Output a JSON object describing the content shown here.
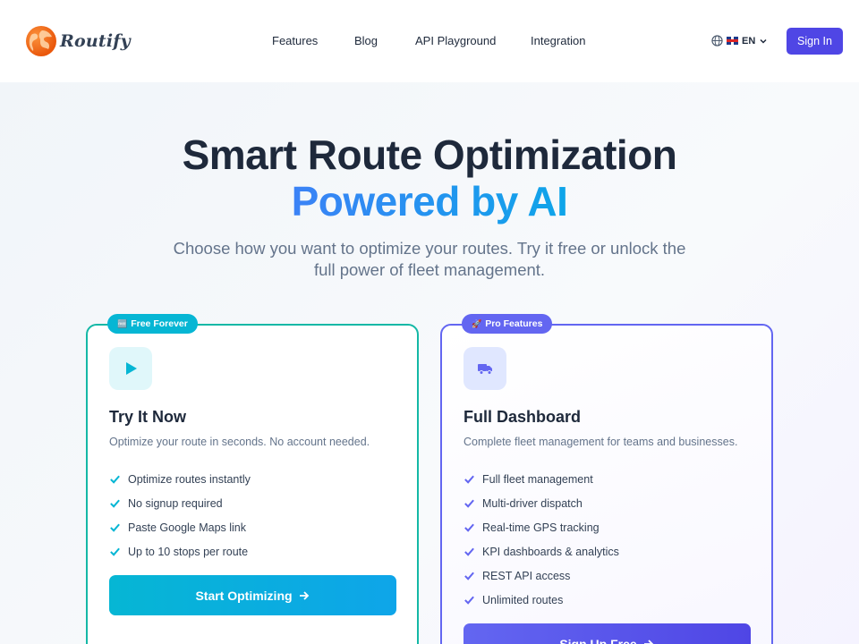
{
  "brand": {
    "name": "Routify"
  },
  "nav": {
    "links": [
      "Features",
      "Blog",
      "API Playground",
      "Integration"
    ]
  },
  "language": {
    "code": "EN",
    "flag": "🇬🇧"
  },
  "signin_label": "Sign In",
  "hero": {
    "title_line1": "Smart Route Optimization",
    "title_line2": "Powered by AI",
    "subtitle": "Choose how you want to optimize your routes. Try it free or unlock the full power of fleet management."
  },
  "free_card": {
    "badge": "Free Forever",
    "badge_icon": "🆓",
    "icon": "play-icon",
    "title": "Try It Now",
    "description": "Optimize your route in seconds. No account needed.",
    "features": [
      "Optimize routes instantly",
      "No signup required",
      "Paste Google Maps link",
      "Up to 10 stops per route"
    ],
    "cta": "Start Optimizing",
    "accent": "#06b6d4"
  },
  "pro_card": {
    "badge": "Pro Features",
    "badge_icon": "🚀",
    "icon": "truck-icon",
    "title": "Full Dashboard",
    "description": "Complete fleet management for teams and businesses.",
    "features": [
      "Full fleet management",
      "Multi-driver dispatch",
      "Real-time GPS tracking",
      "KPI dashboards & analytics",
      "REST API access",
      "Unlimited routes"
    ],
    "cta": "Sign Up Free",
    "accent": "#6366f1"
  }
}
